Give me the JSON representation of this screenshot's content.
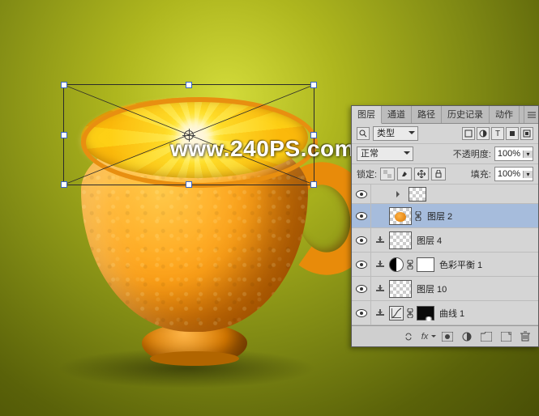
{
  "watermark": "www.240PS.com",
  "panel": {
    "tabs": [
      "图层",
      "通道",
      "路径",
      "历史记录",
      "动作"
    ],
    "active_tab": 0,
    "filter_row": {
      "kind_icon": "search",
      "kind_select": "类型",
      "filters": [
        "img",
        "adj",
        "T",
        "shape",
        "fx"
      ]
    },
    "blend_row": {
      "blend": "正常",
      "opacity_label": "不透明度:",
      "opacity_value": "100%"
    },
    "lock_row": {
      "lock_label": "锁定:",
      "fill_label": "填充:",
      "fill_value": "100%"
    },
    "layers": [
      {
        "type": "group-stub",
        "visible": true
      },
      {
        "type": "layer",
        "visible": true,
        "thumb": "checker blob",
        "name": "图层 2",
        "selected": true,
        "linked": true
      },
      {
        "type": "layer",
        "visible": true,
        "clipped": true,
        "thumb": "checker",
        "name": "图层 4"
      },
      {
        "type": "adjustment",
        "visible": true,
        "clipped": true,
        "icon": "balance",
        "mask": "white",
        "name": "色彩平衡 1"
      },
      {
        "type": "layer",
        "visible": true,
        "clipped": true,
        "thumb": "checker",
        "name": "图层 10"
      },
      {
        "type": "adjustment",
        "visible": true,
        "clipped": true,
        "icon": "curves",
        "mask": "dark",
        "name": "曲线 1"
      }
    ],
    "bottom_icons": [
      "link",
      "fx",
      "mask",
      "adjust",
      "group",
      "new",
      "trash"
    ],
    "fx_label": "fx"
  }
}
